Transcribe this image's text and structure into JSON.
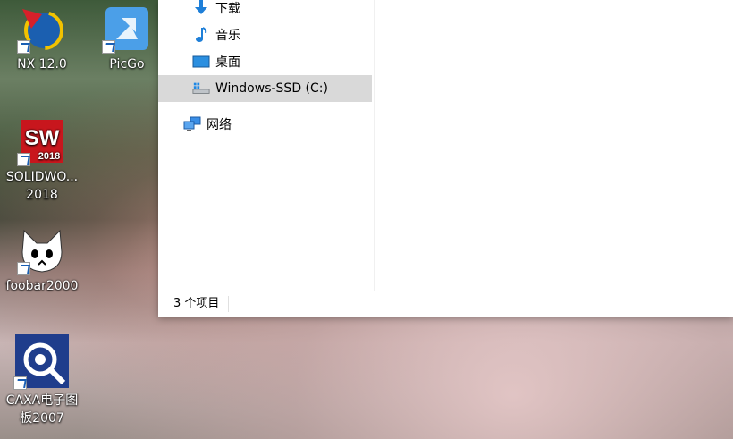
{
  "desktop": {
    "icons": [
      {
        "label": "NX 12.0"
      },
      {
        "label": "PicGo"
      },
      {
        "label": "SOLIDWO...\n2018",
        "line1": "SOLIDWO...",
        "line2": "2018",
        "badge": "SW",
        "badge_year": "2018"
      },
      {
        "label": "foobar2000"
      },
      {
        "label_line1": "CAXA电子图",
        "label_line2": "板2007"
      }
    ]
  },
  "explorer": {
    "nav": {
      "downloads": "下载",
      "music": "音乐",
      "desktop": "桌面",
      "drive_c": "Windows-SSD (C:)",
      "network": "网络"
    },
    "status": {
      "item_count": "3 个项目"
    }
  },
  "colors": {
    "selection": "#d9d9d9",
    "accent": "#0078d7"
  }
}
